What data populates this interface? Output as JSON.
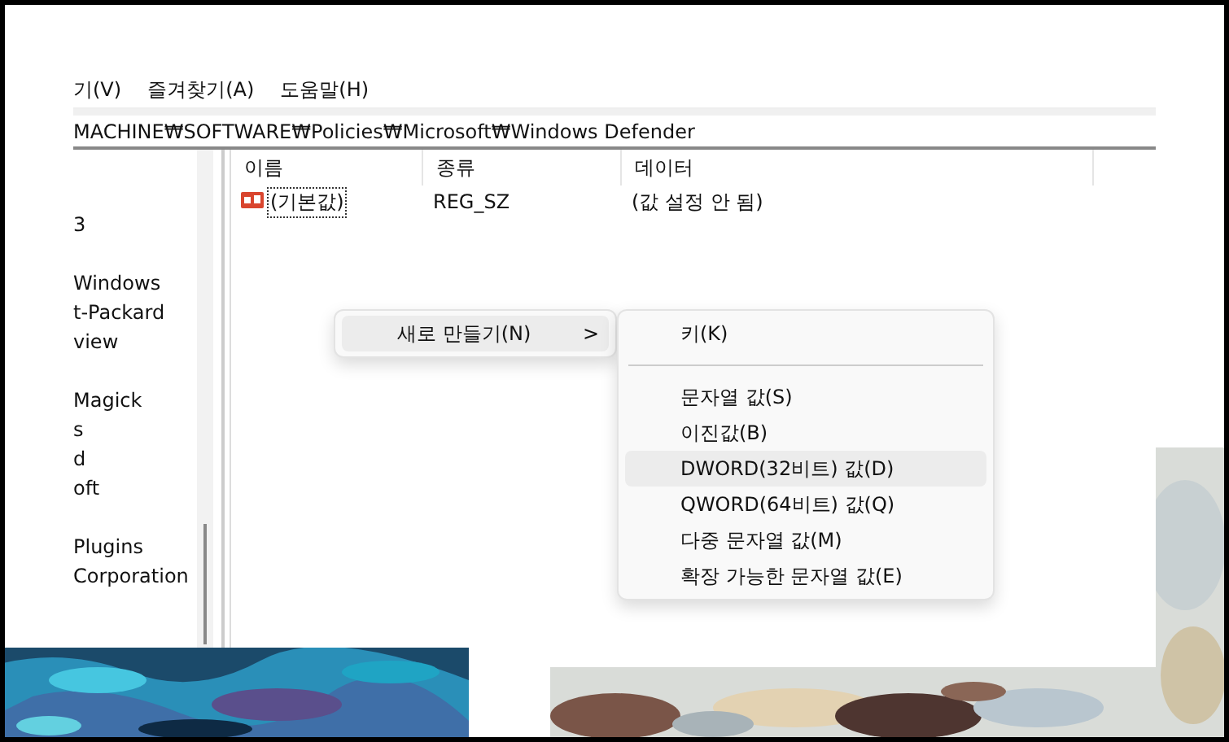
{
  "menu_bar": [
    {
      "label": "기(V)"
    },
    {
      "label": "즐겨찾기(A)"
    },
    {
      "label": "도움말(H)"
    }
  ],
  "address": "MACHINE₩SOFTWARE₩Policies₩Microsoft₩Windows Defender",
  "tree": {
    "items": [
      {
        "label": "3"
      },
      {
        "label": "Windows"
      },
      {
        "label": "t-Packard"
      },
      {
        "label": "view"
      },
      {
        "label": "Magick"
      },
      {
        "label": "s"
      },
      {
        "label": "d"
      },
      {
        "label": "oft"
      },
      {
        "label": "Plugins"
      },
      {
        "label": "Corporation"
      }
    ]
  },
  "list": {
    "columns": [
      "이름",
      "종류",
      "데이터"
    ],
    "rows": [
      {
        "name": "(기본값)",
        "type": "REG_SZ",
        "data": "(값 설정 안 됨)"
      }
    ]
  },
  "context_menu": {
    "items": [
      {
        "label": "새로 만들기(N)",
        "selected": true,
        "submenu": ">"
      }
    ]
  },
  "submenu": {
    "items": [
      {
        "kind": "item",
        "label": "키(K)",
        "selected": false
      },
      {
        "kind": "separator"
      },
      {
        "kind": "item",
        "label": "문자열 값(S)",
        "selected": false
      },
      {
        "kind": "item",
        "label": "이진값(B)",
        "selected": false
      },
      {
        "kind": "item",
        "label": "DWORD(32비트) 값(D)",
        "selected": true
      },
      {
        "kind": "item",
        "label": "QWORD(64비트) 값(Q)",
        "selected": false
      },
      {
        "kind": "item",
        "label": "다중 문자열 값(M)",
        "selected": false
      },
      {
        "kind": "item",
        "label": "확장 가능한 문자열 값(E)",
        "selected": false
      }
    ]
  }
}
